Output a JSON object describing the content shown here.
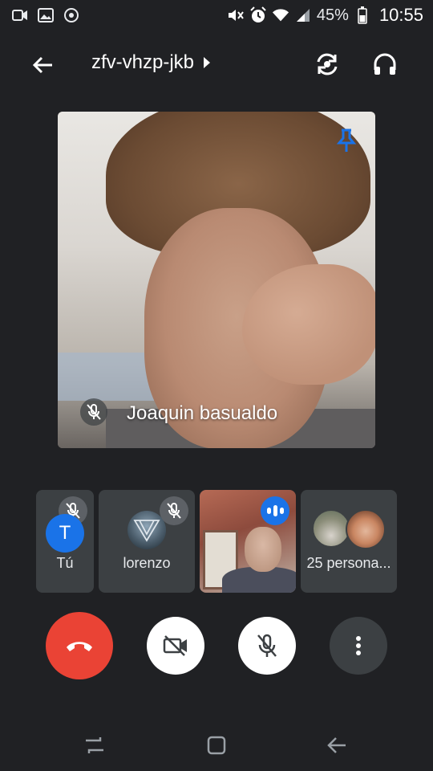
{
  "status_bar": {
    "battery_percent": "45%",
    "time": "10:55",
    "icons": [
      "video-call-icon",
      "gallery-icon",
      "sync-icon",
      "mute-icon",
      "alarm-icon",
      "wifi-icon",
      "signal-icon",
      "battery-icon"
    ]
  },
  "header": {
    "meeting_code": "zfv-vhzp-jkb",
    "icons": [
      "back-arrow-icon",
      "switch-camera-icon",
      "headphones-icon"
    ]
  },
  "main_video": {
    "participant_name": "Joaquin basualdo",
    "pinned": true,
    "muted": true
  },
  "participants": [
    {
      "label": "Tú",
      "avatar_letter": "T",
      "avatar_color": "#1a73e8",
      "muted": true
    },
    {
      "label": "lorenzo",
      "muted": true
    },
    {
      "label": "",
      "speaking": true,
      "video": true
    },
    {
      "label": "25 persona..."
    }
  ],
  "controls": {
    "end_call_color": "#ea4335",
    "icons": [
      "end-call-icon",
      "camera-off-icon",
      "mic-off-icon",
      "more-options-icon"
    ]
  },
  "nav_bar": {
    "icons": [
      "recent-apps-icon",
      "home-icon",
      "back-icon"
    ]
  }
}
